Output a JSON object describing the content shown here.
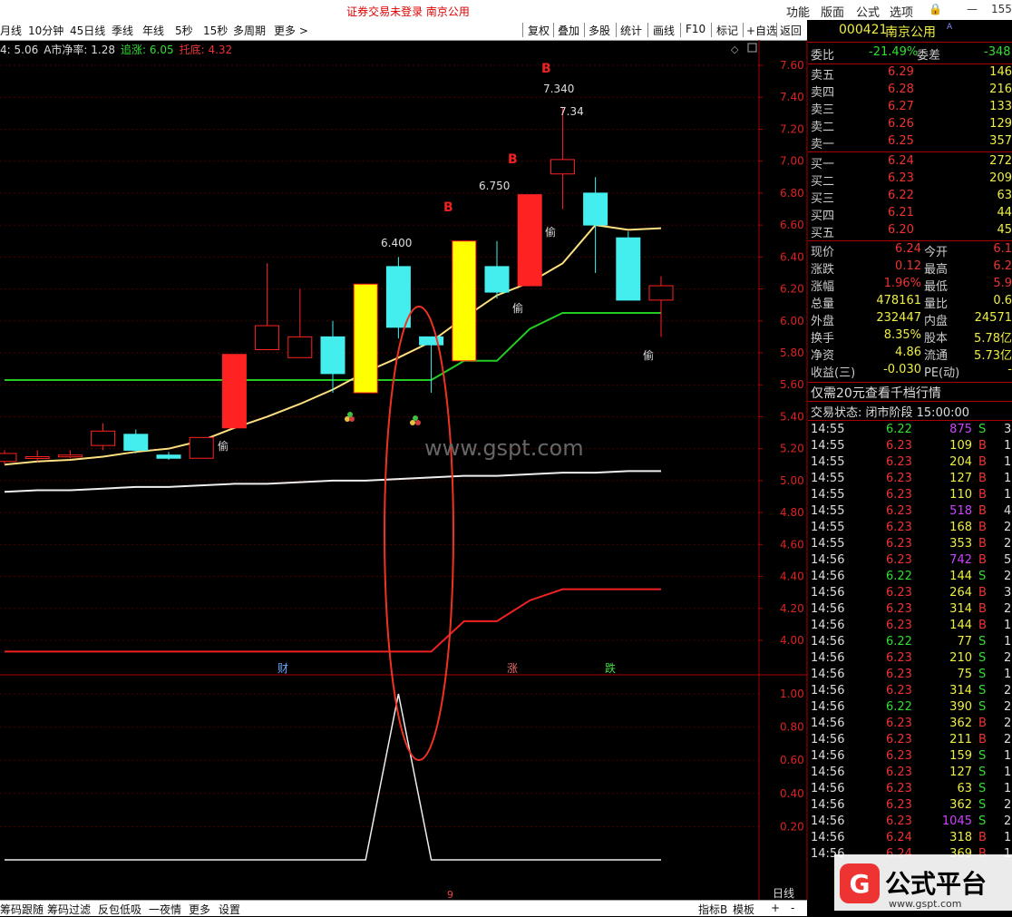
{
  "titlebar": {
    "title": "证券交易未登录   南京公用",
    "menu": [
      "功能",
      "版面",
      "公式",
      "选项"
    ],
    "right_num": "155"
  },
  "periods": [
    "月线",
    "10分钟",
    "45日线",
    "季线",
    "年线",
    "5秒",
    "15秒",
    "多周期",
    "更多 >"
  ],
  "tools": [
    "复权",
    "叠加",
    "多股",
    "统计",
    "画线",
    "F10",
    "标记",
    "+自选",
    "返回"
  ],
  "legend": {
    "l0": "4: 5.06",
    "l1": "A市净率: 1.28",
    "l2": "追涨: 6.05",
    "l3": "托底: 4.32"
  },
  "price_axis": [
    "7.60",
    "7.40",
    "7.20",
    "7.00",
    "6.80",
    "6.60",
    "6.40",
    "6.20",
    "6.00",
    "5.80",
    "5.60",
    "5.40",
    "5.20",
    "5.00",
    "4.80",
    "4.60",
    "4.40",
    "4.20",
    "4.00"
  ],
  "sub_axis": [
    "1.00",
    "0.80",
    "0.60",
    "0.40",
    "0.20"
  ],
  "annotations": {
    "p6400": "6.400",
    "p6750": "6.750",
    "p7340": "7.340",
    "p734": "7.34",
    "b": "B",
    "tou": "偷",
    "cai": "财",
    "zhang": "涨",
    "die": "跌",
    "watermark": "www.gspt.com",
    "nine": "9",
    "rixian": "日线"
  },
  "candles": [
    {
      "o": 5.12,
      "c": 5.17,
      "h": 5.19,
      "l": 5.1
    },
    {
      "o": 5.14,
      "c": 5.15,
      "h": 5.19,
      "l": 5.12
    },
    {
      "o": 5.15,
      "c": 5.16,
      "h": 5.19,
      "l": 5.14
    },
    {
      "o": 5.22,
      "c": 5.31,
      "h": 5.36,
      "l": 5.19
    },
    {
      "o": 5.29,
      "c": 5.19,
      "h": 5.32,
      "l": 5.17
    },
    {
      "o": 5.16,
      "c": 5.14,
      "h": 5.18,
      "l": 5.13
    },
    {
      "o": 5.14,
      "c": 5.27,
      "h": 5.27,
      "l": 5.14
    },
    {
      "o": 5.33,
      "c": 5.79,
      "h": 5.79,
      "l": 5.33
    },
    {
      "o": 5.82,
      "c": 5.97,
      "h": 6.36,
      "l": 5.82
    },
    {
      "o": 5.77,
      "c": 5.9,
      "h": 6.2,
      "l": 5.77
    },
    {
      "o": 5.9,
      "c": 5.67,
      "h": 6.0,
      "l": 5.55
    },
    {
      "o": 5.55,
      "c": 6.23,
      "h": 6.23,
      "l": 5.55,
      "yellow": true
    },
    {
      "o": 6.34,
      "c": 5.96,
      "h": 6.4,
      "l": 5.89
    },
    {
      "o": 5.9,
      "c": 5.85,
      "h": 5.9,
      "l": 5.55
    },
    {
      "o": 5.75,
      "c": 6.5,
      "h": 6.5,
      "l": 5.75,
      "yellow": true
    },
    {
      "o": 6.34,
      "c": 6.18,
      "h": 6.5,
      "l": 6.14
    },
    {
      "o": 6.22,
      "c": 6.79,
      "h": 6.79,
      "l": 6.22
    },
    {
      "o": 6.92,
      "c": 7.01,
      "h": 7.34,
      "l": 6.7
    },
    {
      "o": 6.8,
      "c": 6.6,
      "h": 6.9,
      "l": 6.3
    },
    {
      "o": 6.52,
      "c": 6.13,
      "h": 6.56,
      "l": 6.13
    },
    {
      "o": 6.13,
      "c": 6.22,
      "h": 6.28,
      "l": 5.9
    }
  ],
  "lines": {
    "ma": [
      5.1,
      5.12,
      5.13,
      5.15,
      5.18,
      5.2,
      5.25,
      5.33,
      5.4,
      5.48,
      5.57,
      5.68,
      5.77,
      5.87,
      6.02,
      6.16,
      6.24,
      6.36,
      6.6,
      6.57,
      6.58
    ],
    "green": [
      5.63,
      5.63,
      5.63,
      5.63,
      5.63,
      5.63,
      5.63,
      5.63,
      5.63,
      5.63,
      5.63,
      5.63,
      5.63,
      5.63,
      5.75,
      5.75,
      5.95,
      6.05,
      6.05,
      6.05,
      6.05
    ],
    "white": [
      4.93,
      4.94,
      4.94,
      4.95,
      4.96,
      4.96,
      4.97,
      4.98,
      4.98,
      4.99,
      5.0,
      5.0,
      5.01,
      5.02,
      5.03,
      5.03,
      5.04,
      5.05,
      5.05,
      5.06,
      5.06
    ],
    "red": [
      3.93,
      3.93,
      3.93,
      3.93,
      3.93,
      3.93,
      3.93,
      3.93,
      3.93,
      3.93,
      3.93,
      3.93,
      3.93,
      3.93,
      4.12,
      4.12,
      4.25,
      4.32,
      4.32,
      4.32,
      4.32
    ],
    "sub": [
      0,
      0,
      0,
      0,
      0,
      0,
      0,
      0,
      0,
      0,
      0,
      0,
      1,
      0,
      0,
      0,
      0,
      0,
      0,
      0,
      0
    ]
  },
  "panel": {
    "code": "000421",
    "name": "南京公用",
    "weibi_label": "委比",
    "weibi": "-21.49%",
    "weicha_label": "委差",
    "weicha": "-348",
    "sells": [
      {
        "l": "卖五",
        "p": "6.29",
        "v": "146"
      },
      {
        "l": "卖四",
        "p": "6.28",
        "v": "216"
      },
      {
        "l": "卖三",
        "p": "6.27",
        "v": "133"
      },
      {
        "l": "卖二",
        "p": "6.26",
        "v": "129"
      },
      {
        "l": "卖一",
        "p": "6.25",
        "v": "357"
      }
    ],
    "buys": [
      {
        "l": "买一",
        "p": "6.24",
        "v": "272"
      },
      {
        "l": "买二",
        "p": "6.23",
        "v": "209"
      },
      {
        "l": "买三",
        "p": "6.22",
        "v": "63"
      },
      {
        "l": "买四",
        "p": "6.21",
        "v": "44"
      },
      {
        "l": "买五",
        "p": "6.20",
        "v": "45"
      }
    ],
    "stats": [
      {
        "l1": "现价",
        "v1": "6.24",
        "l2": "今开",
        "v2": "6.1"
      },
      {
        "l1": "涨跌",
        "v1": "0.12",
        "l2": "最高",
        "v2": "6.2"
      },
      {
        "l1": "涨幅",
        "v1": "1.96%",
        "l2": "最低",
        "v2": "5.9"
      },
      {
        "l1": "总量",
        "v1": "478161",
        "l2": "量比",
        "v2": "0.6"
      },
      {
        "l1": "外盘",
        "v1": "232447",
        "l2": "内盘",
        "v2": "24571"
      },
      {
        "l1": "换手",
        "v1": "8.35%",
        "l2": "股本",
        "v2": "5.78亿"
      },
      {
        "l1": "净资",
        "v1": "4.86",
        "l2": "流通",
        "v2": "5.73亿"
      },
      {
        "l1": "收益(三)",
        "v1": "-0.030",
        "l2": "PE(动)",
        "v2": "-"
      }
    ],
    "promo": "仅需20元查看千档行情",
    "status": "交易状态: 闭市阶段 15:00:00",
    "ticks": [
      {
        "t": "14:55",
        "p": "6.22",
        "v": "875",
        "s": "S",
        "n": "3"
      },
      {
        "t": "14:55",
        "p": "6.23",
        "v": "109",
        "s": "B",
        "n": "1"
      },
      {
        "t": "14:55",
        "p": "6.23",
        "v": "204",
        "s": "B",
        "n": "1"
      },
      {
        "t": "14:55",
        "p": "6.23",
        "v": "127",
        "s": "B",
        "n": "1"
      },
      {
        "t": "14:55",
        "p": "6.23",
        "v": "110",
        "s": "B",
        "n": "1"
      },
      {
        "t": "14:55",
        "p": "6.23",
        "v": "518",
        "s": "B",
        "n": "4"
      },
      {
        "t": "14:55",
        "p": "6.23",
        "v": "168",
        "s": "B",
        "n": "2"
      },
      {
        "t": "14:55",
        "p": "6.23",
        "v": "353",
        "s": "B",
        "n": "2"
      },
      {
        "t": "14:56",
        "p": "6.23",
        "v": "742",
        "s": "B",
        "n": "5"
      },
      {
        "t": "14:56",
        "p": "6.22",
        "v": "144",
        "s": "S",
        "n": "2"
      },
      {
        "t": "14:56",
        "p": "6.23",
        "v": "264",
        "s": "B",
        "n": "3"
      },
      {
        "t": "14:56",
        "p": "6.23",
        "v": "314",
        "s": "B",
        "n": "2"
      },
      {
        "t": "14:56",
        "p": "6.23",
        "v": "144",
        "s": "B",
        "n": "1"
      },
      {
        "t": "14:56",
        "p": "6.22",
        "v": "77",
        "s": "S",
        "n": "1"
      },
      {
        "t": "14:56",
        "p": "6.23",
        "v": "210",
        "s": "S",
        "n": "2"
      },
      {
        "t": "14:56",
        "p": "6.23",
        "v": "75",
        "s": "S",
        "n": "1"
      },
      {
        "t": "14:56",
        "p": "6.23",
        "v": "314",
        "s": "S",
        "n": "2"
      },
      {
        "t": "14:56",
        "p": "6.22",
        "v": "390",
        "s": "S",
        "n": "2"
      },
      {
        "t": "14:56",
        "p": "6.23",
        "v": "362",
        "s": "B",
        "n": "2"
      },
      {
        "t": "14:56",
        "p": "6.23",
        "v": "211",
        "s": "B",
        "n": "2"
      },
      {
        "t": "14:56",
        "p": "6.23",
        "v": "159",
        "s": "S",
        "n": "1"
      },
      {
        "t": "14:56",
        "p": "6.23",
        "v": "127",
        "s": "S",
        "n": "1"
      },
      {
        "t": "14:56",
        "p": "6.23",
        "v": "63",
        "s": "S",
        "n": "1"
      },
      {
        "t": "14:56",
        "p": "6.23",
        "v": "362",
        "s": "S",
        "n": "2"
      },
      {
        "t": "14:56",
        "p": "6.23",
        "v": "1045",
        "s": "S",
        "n": "2"
      },
      {
        "t": "14:56",
        "p": "6.24",
        "v": "318",
        "s": "B",
        "n": "1"
      },
      {
        "t": "14:56",
        "p": "6.24",
        "v": "369",
        "s": "B",
        "n": "1"
      }
    ]
  },
  "bottom": {
    "items": [
      "筹码跟随",
      "筹码过滤",
      "反包低吸",
      "一夜情",
      "更多",
      "设置"
    ],
    "right": [
      "指标B",
      "模板",
      "+",
      "-"
    ]
  },
  "logo": {
    "text": "公式平台",
    "url": "www.gspt.com"
  }
}
